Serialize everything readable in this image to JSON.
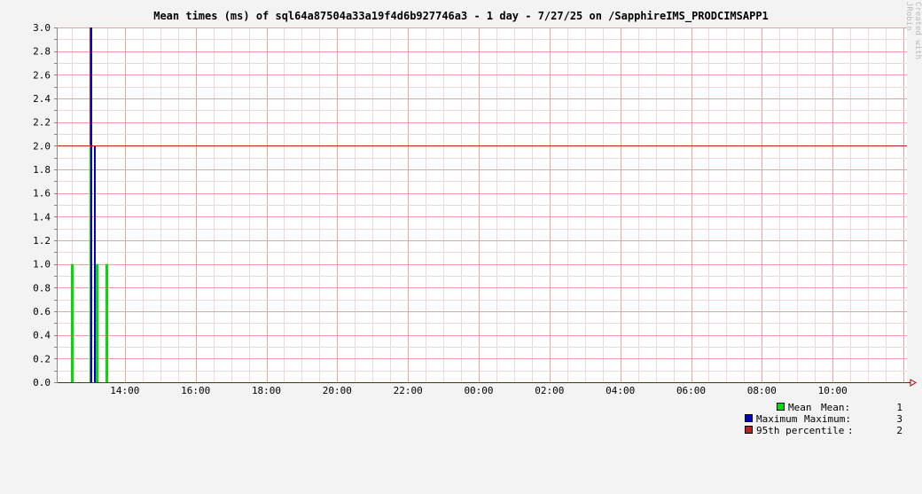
{
  "chart_data": {
    "type": "bar",
    "title": "Mean times (ms) of sql64a87504a33a19f4d6b927746a3 - 1 day - 7/27/25 on /SapphireIMS_PRODCIMSAPP1",
    "credit": "Created with JRobin",
    "xlabel": "",
    "ylabel": "",
    "ylim": [
      0.0,
      3.0
    ],
    "y_ticks": [
      "0.0",
      "0.2",
      "0.4",
      "0.6",
      "0.8",
      "1.0",
      "1.2",
      "1.4",
      "1.6",
      "1.8",
      "2.0",
      "2.2",
      "2.4",
      "2.6",
      "2.8",
      "3.0"
    ],
    "x_ticks": [
      {
        "hour": 14,
        "label": "14:00"
      },
      {
        "hour": 16,
        "label": "16:00"
      },
      {
        "hour": 18,
        "label": "18:00"
      },
      {
        "hour": 20,
        "label": "20:00"
      },
      {
        "hour": 22,
        "label": "22:00"
      },
      {
        "hour": 24,
        "label": "00:00"
      },
      {
        "hour": 26,
        "label": "02:00"
      },
      {
        "hour": 28,
        "label": "04:00"
      },
      {
        "hour": 30,
        "label": "06:00"
      },
      {
        "hour": 32,
        "label": "08:00"
      },
      {
        "hour": 34,
        "label": "10:00"
      }
    ],
    "x_range_hours": [
      12.1,
      36.1
    ],
    "grid": true,
    "hline": {
      "value": 2.0,
      "color": "#bb2222"
    },
    "series": [
      {
        "name": "Mean",
        "color": "#00dd00",
        "stat_label": "Mean:",
        "stat_value": "1",
        "points": [
          {
            "t": 12.47,
            "v": 1
          },
          {
            "t": 13.0,
            "v": 2
          },
          {
            "t": 13.18,
            "v": 1
          },
          {
            "t": 13.45,
            "v": 1
          }
        ]
      },
      {
        "name": "Maximum",
        "color": "#0000cc",
        "stat_label": "Maximum:",
        "stat_value": "3",
        "points": [
          {
            "t": 13.03,
            "v": 3
          },
          {
            "t": 13.12,
            "v": 2
          }
        ]
      },
      {
        "name": "95th percentile",
        "color": "#bb2222",
        "stat_label": ":",
        "stat_value": "2",
        "points": [
          {
            "t": 13.0,
            "v": 3
          }
        ]
      }
    ],
    "legend_position": "bottom-right"
  }
}
